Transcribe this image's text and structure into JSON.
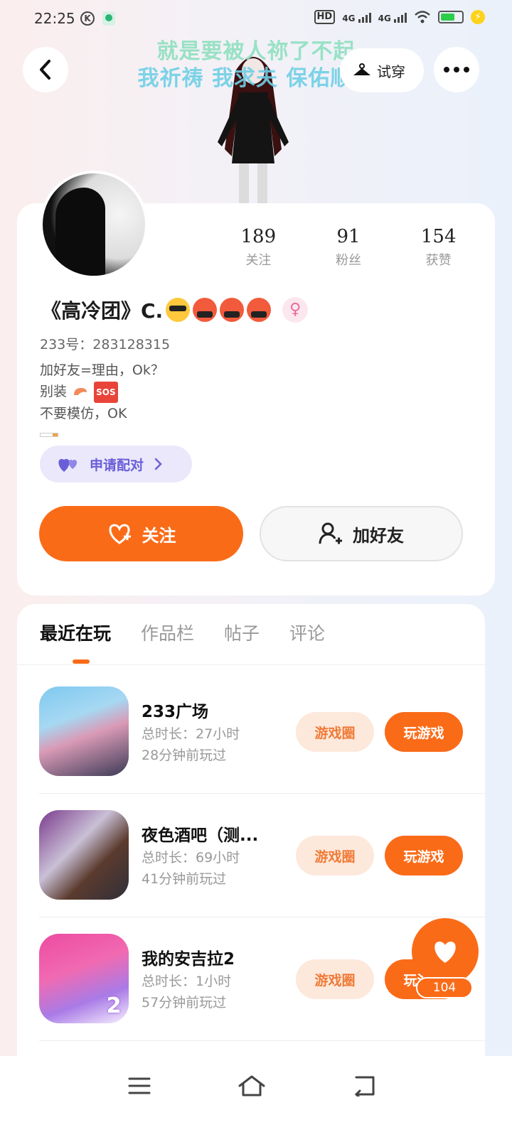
{
  "status_bar": {
    "time": "22:25",
    "k_icon_letter": "K",
    "hd_label": "HD",
    "network_1": "4G",
    "network_2": "4G"
  },
  "header": {
    "banner_line1": "就是要被人祢了不起",
    "banner_line2": "我祈祷 我求夫 保佑顺意",
    "tryon_label": "试穿"
  },
  "profile": {
    "stats": [
      {
        "value": "189",
        "label": "关注"
      },
      {
        "value": "91",
        "label": "粉丝"
      },
      {
        "value": "154",
        "label": "获赞"
      }
    ],
    "username": "《高冷团》C.",
    "gender_symbol": "♀",
    "uid": "233号：283128315",
    "bio": {
      "line1": "加好友=理由，Ok？",
      "line2": "别装",
      "sos": "SOS",
      "line3": "不要模仿，OK"
    },
    "pair_label": "申请配对",
    "follow_label": "关注",
    "add_friend_label": "加好友"
  },
  "tabs": [
    {
      "label": "最近在玩"
    },
    {
      "label": "作品栏"
    },
    {
      "label": "帖子"
    },
    {
      "label": "评论"
    }
  ],
  "games": [
    {
      "name": "233广场",
      "duration": "总时长：27小时",
      "last_played": "28分钟前玩过",
      "circle_label": "游戏圈",
      "play_label": "玩游戏"
    },
    {
      "name": "夜色酒吧（测...",
      "duration": "总时长：69小时",
      "last_played": "41分钟前玩过",
      "circle_label": "游戏圈",
      "play_label": "玩游戏"
    },
    {
      "name": "我的安吉拉2",
      "duration": "总时长：1小时",
      "last_played": "57分钟前玩过",
      "circle_label": "游戏圈",
      "play_label": "玩游戏",
      "badge": "2"
    }
  ],
  "like_fab": {
    "count": "104"
  },
  "colors": {
    "accent": "#fa6b18",
    "accent_light": "#fde8dc",
    "pair_bg": "#ebe8fb",
    "pair_text": "#6a5ed8"
  }
}
